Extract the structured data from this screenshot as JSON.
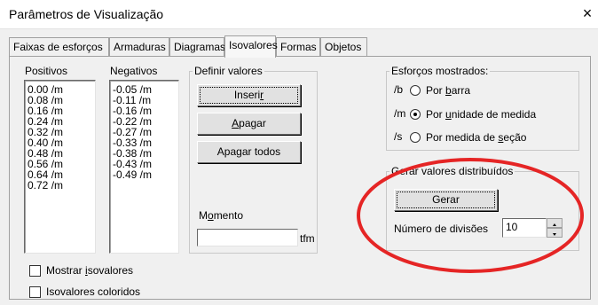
{
  "window": {
    "title": "Parâmetros de Visualização",
    "close_glyph": "×"
  },
  "tabs": [
    {
      "label": "Faixas de esforços",
      "active": false
    },
    {
      "label": "Armaduras",
      "active": false
    },
    {
      "label": "Diagramas",
      "active": false
    },
    {
      "label": "Isovalores",
      "active": true
    },
    {
      "label": "Formas",
      "active": false
    },
    {
      "label": "Objetos",
      "active": false
    }
  ],
  "lists": {
    "positivos_label": "Positivos",
    "negativos_label": "Negativos",
    "positivos": [
      "0.00 /m",
      "0.08 /m",
      "0.16 /m",
      "0.24 /m",
      "0.32 /m",
      "0.40 /m",
      "0.48 /m",
      "0.56 /m",
      "0.64 /m",
      "0.72 /m"
    ],
    "negativos": [
      "-0.05 /m",
      "-0.11 /m",
      "-0.16 /m",
      "-0.22 /m",
      "-0.27 /m",
      "-0.33 /m",
      "-0.38 /m",
      "-0.43 /m",
      "-0.49 /m"
    ]
  },
  "definir": {
    "legend": "Definir valores",
    "inserir_pre": "Inseri",
    "inserir_ul": "r",
    "inserir_post": "",
    "apagar_pre": "",
    "apagar_ul": "A",
    "apagar_post": "pagar",
    "apagar_todos": "Apagar todos"
  },
  "momento": {
    "label_pre": "M",
    "label_ul": "o",
    "label_post": "mento",
    "value": "",
    "unit": "tfm"
  },
  "esforcos": {
    "legend": "Esforços mostrados:",
    "options": [
      {
        "prefix": "/b",
        "label_pre": "Por ",
        "label_ul": "b",
        "label_post": "arra",
        "checked": false
      },
      {
        "prefix": "/m",
        "label_pre": "Por ",
        "label_ul": "u",
        "label_post": "nidade de medida",
        "checked": true
      },
      {
        "prefix": "/s",
        "label_pre": "Por medida de ",
        "label_ul": "s",
        "label_post": "eção",
        "checked": false
      }
    ]
  },
  "gerar": {
    "legend": "Gerar valores distribuídos",
    "button": "Gerar",
    "divisoes_label": "Número de divisões",
    "divisoes_value": "10"
  },
  "checkboxes": {
    "mostrar_pre": "Mostrar ",
    "mostrar_ul": "i",
    "mostrar_post": "sovalores",
    "coloridos": "Isovalores coloridos"
  },
  "annotation": {
    "color": "#e52525"
  }
}
